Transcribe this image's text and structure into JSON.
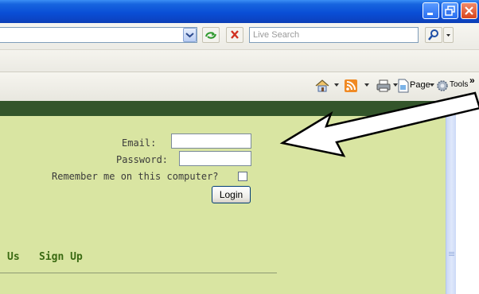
{
  "browser": {
    "search_placeholder": "Live Search",
    "commands": {
      "page": "Page",
      "tools": "Tools"
    }
  },
  "login": {
    "email_label": "Email:",
    "email_value": "",
    "password_label": "Password:",
    "password_value": "",
    "remember_label": "Remember me on this computer?",
    "remember_checked": false,
    "login_button": "Login"
  },
  "nav": {
    "partial_link": "Us",
    "signup_link": "Sign Up"
  },
  "colors": {
    "page_bg": "#d9e5a2",
    "header_band": "#33552b",
    "link_green": "#3a6a12"
  },
  "icons": [
    "minimize-icon",
    "maximize-icon",
    "close-icon",
    "dropdown-chevron-icon",
    "refresh-icon",
    "stop-icon",
    "search-icon",
    "home-icon",
    "rss-feed-icon",
    "print-icon",
    "page-icon",
    "tools-gear-icon",
    "toolbar-overflow-icon",
    "pointer-arrow"
  ]
}
